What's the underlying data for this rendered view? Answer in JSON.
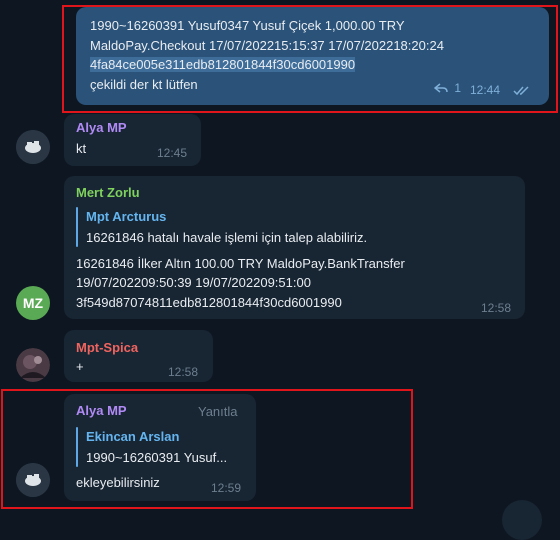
{
  "colors": {
    "background": "#0e1621",
    "incoming_bubble": "#182533",
    "outgoing_bubble": "#2b5278",
    "highlight_box": "#e0151c",
    "name_alya": "#b18bf5",
    "name_mert": "#7fd25d",
    "name_spica": "#f0645f",
    "reply_accent": "#5fa8e6"
  },
  "msg1": {
    "line1": "1990~16260391  Yusuf0347  Yusuf  Çiçek  1,000.00  TRY",
    "line2": "MaldoPay.Checkout    17/07/202215:15:37  17/07/202218:20:24",
    "line3": "4fa84ce005e311edb812801844f30cd6001990",
    "line4": "çekildi der kt lütfen",
    "reply_count": "1",
    "time": "12:44",
    "reply_icon": "reply-arrow-icon",
    "status_icon": "double-check-icon"
  },
  "msg2": {
    "sender": "Alya MP",
    "text": "kt",
    "time": "12:45"
  },
  "msg3": {
    "sender": "Mert Zorlu",
    "avatar_initials": "MZ",
    "quote_name": "Mpt Arcturus",
    "quote_text": "16261846 hatalı havale işlemi için talep alabiliriz.",
    "line1": "16261846  İlker  Altın  100.00  TRY  MaldoPay.BankTransfer",
    "line2": "19/07/202209:50:39  19/07/202209:51:00",
    "line3": "3f549d87074811edb812801844f30cd6001990",
    "time": "12:58"
  },
  "msg4": {
    "sender": "Mpt-Spica",
    "text": "+",
    "time": "12:58"
  },
  "msg5": {
    "sender": "Alya MP",
    "reply_action": "Yanıtla",
    "quote_name": "Ekincan Arslan",
    "quote_text": "1990~16260391  Yusuf...",
    "text": "ekleyebilirsiniz",
    "time": "12:59"
  }
}
